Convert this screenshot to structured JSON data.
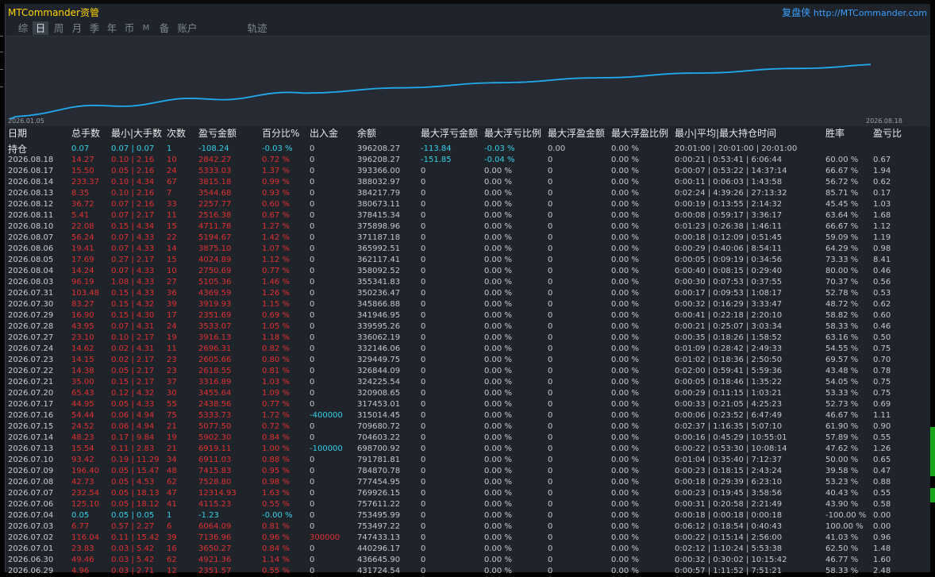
{
  "app": {
    "title": "MTCommander资管",
    "brand_cn": "复盘侠",
    "brand_url": "http://MTCommander.com"
  },
  "tabs": [
    "综",
    "日",
    "周",
    "月",
    "季",
    "年",
    "币",
    "M",
    "备",
    "账户",
    "轨迹"
  ],
  "active_tab": 1,
  "chart_data": {
    "type": "line",
    "x_start_label": "2026.01.05",
    "x_end_label": "2026.08.18",
    "line_color": "#22aaee"
  },
  "columns": [
    "日期",
    "总手数",
    "最小|大手数",
    "次数",
    "盈亏金额",
    "百分比%",
    "出入金",
    "余额",
    "最大浮亏金额",
    "最大浮亏比例",
    "最大浮盈金额",
    "最大浮盈比例",
    "最小|平均|最大持仓时间",
    "胜率",
    "盈亏比"
  ],
  "position_row": {
    "label": "持仓",
    "lots": "0.07",
    "minmax": "0.07 | 0.07",
    "count": "1",
    "pnl": "-108.24",
    "pct": "-0.03 %",
    "flow": "0",
    "balance": "396208.27",
    "float_loss": "-113.84",
    "float_loss_pct": "-0.03 %",
    "float_profit": "0.00",
    "float_profit_pct": "0.00 %",
    "hold_time": "20:01:00 | 20:01:00 | 20:01:00",
    "winrate": "",
    "pf": ""
  },
  "rows": [
    {
      "date": "2026.08.18",
      "lots": "14.27",
      "minmax": "0.10 | 2.16",
      "count": "10",
      "pnl": "2842.27",
      "pct": "0.72 %",
      "flow": "0",
      "balance": "396208.27",
      "float_loss": "-151.85",
      "float_loss_pct": "-0.04 %",
      "float_profit": "0",
      "float_profit_pct": "0.00 %",
      "hold_time": "0:00:21 | 0:53:41 | 6:06:44",
      "winrate": "60.00 %",
      "pf": "0.67"
    },
    {
      "date": "2026.08.17",
      "lots": "15.50",
      "minmax": "0.05 | 2.16",
      "count": "24",
      "pnl": "5333.03",
      "pct": "1.37 %",
      "flow": "0",
      "balance": "393366.00",
      "float_loss": "0",
      "float_loss_pct": "0.00 %",
      "float_profit": "0",
      "float_profit_pct": "0.00 %",
      "hold_time": "0:00:07 | 0:53:22 | 14:37:14",
      "winrate": "66.67 %",
      "pf": "1.94"
    },
    {
      "date": "2026.08.14",
      "lots": "233.37",
      "minmax": "0.10 | 4.34",
      "count": "67",
      "pnl": "3815.18",
      "pct": "0.99 %",
      "flow": "0",
      "balance": "388032.97",
      "float_loss": "0",
      "float_loss_pct": "0.00 %",
      "float_profit": "0",
      "float_profit_pct": "0.00 %",
      "hold_time": "0:00:11 | 0:06:03 | 1:43:58",
      "winrate": "56.72 %",
      "pf": "0.62"
    },
    {
      "date": "2026.08.13",
      "lots": "8.35",
      "minmax": "0.10 | 2.16",
      "count": "7",
      "pnl": "3544.68",
      "pct": "0.93 %",
      "flow": "0",
      "balance": "384217.79",
      "float_loss": "0",
      "float_loss_pct": "0.00 %",
      "float_profit": "0",
      "float_profit_pct": "0.00 %",
      "hold_time": "0:02:24 | 4:39:26 | 27:13:32",
      "winrate": "85.71 %",
      "pf": "0.17"
    },
    {
      "date": "2026.08.12",
      "lots": "36.72",
      "minmax": "0.07 | 2.16",
      "count": "33",
      "pnl": "2257.77",
      "pct": "0.60 %",
      "flow": "0",
      "balance": "380673.11",
      "float_loss": "0",
      "float_loss_pct": "0.00 %",
      "float_profit": "0",
      "float_profit_pct": "0.00 %",
      "hold_time": "0:00:19 | 0:13:55 | 2:14:32",
      "winrate": "45.45 %",
      "pf": "1.03"
    },
    {
      "date": "2026.08.11",
      "lots": "5.41",
      "minmax": "0.07 | 2.17",
      "count": "11",
      "pnl": "2516.38",
      "pct": "0.67 %",
      "flow": "0",
      "balance": "378415.34",
      "float_loss": "0",
      "float_loss_pct": "0.00 %",
      "float_profit": "0",
      "float_profit_pct": "0.00 %",
      "hold_time": "0:00:08 | 0:59:17 | 3:36:17",
      "winrate": "63.64 %",
      "pf": "1.68"
    },
    {
      "date": "2026.08.10",
      "lots": "22.08",
      "minmax": "0.15 | 4.34",
      "count": "15",
      "pnl": "4711.78",
      "pct": "1.27 %",
      "flow": "0",
      "balance": "375898.96",
      "float_loss": "0",
      "float_loss_pct": "0.00 %",
      "float_profit": "0",
      "float_profit_pct": "0.00 %",
      "hold_time": "0:01:23 | 0:26:38 | 1:46:11",
      "winrate": "66.67 %",
      "pf": "1.12"
    },
    {
      "date": "2026.08.07",
      "lots": "56.24",
      "minmax": "0.07 | 4.33",
      "count": "22",
      "pnl": "5194.67",
      "pct": "1.42 %",
      "flow": "0",
      "balance": "371187.18",
      "float_loss": "0",
      "float_loss_pct": "0.00 %",
      "float_profit": "0",
      "float_profit_pct": "0.00 %",
      "hold_time": "0:00:18 | 0:12:09 | 0:51:45",
      "winrate": "59.09 %",
      "pf": "1.19"
    },
    {
      "date": "2026.08.06",
      "lots": "19.41",
      "minmax": "0.07 | 4.33",
      "count": "14",
      "pnl": "3875.10",
      "pct": "1.07 %",
      "flow": "0",
      "balance": "365992.51",
      "float_loss": "0",
      "float_loss_pct": "0.00 %",
      "float_profit": "0",
      "float_profit_pct": "0.00 %",
      "hold_time": "0:00:29 | 0:40:06 | 8:54:11",
      "winrate": "64.29 %",
      "pf": "0.98"
    },
    {
      "date": "2026.08.05",
      "lots": "17.69",
      "minmax": "0.27 | 2.17",
      "count": "15",
      "pnl": "4024.89",
      "pct": "1.12 %",
      "flow": "0",
      "balance": "362117.41",
      "float_loss": "0",
      "float_loss_pct": "0.00 %",
      "float_profit": "0",
      "float_profit_pct": "0.00 %",
      "hold_time": "0:00:05 | 0:09:19 | 0:34:56",
      "winrate": "73.33 %",
      "pf": "8.41"
    },
    {
      "date": "2026.08.04",
      "lots": "14.24",
      "minmax": "0.07 | 4.33",
      "count": "10",
      "pnl": "2750.69",
      "pct": "0.77 %",
      "flow": "0",
      "balance": "358092.52",
      "float_loss": "0",
      "float_loss_pct": "0.00 %",
      "float_profit": "0",
      "float_profit_pct": "0.00 %",
      "hold_time": "0:00:40 | 0:08:15 | 0:29:40",
      "winrate": "80.00 %",
      "pf": "0.46"
    },
    {
      "date": "2026.08.03",
      "lots": "96.19",
      "minmax": "1.08 | 4.33",
      "count": "27",
      "pnl": "5105.36",
      "pct": "1.46 %",
      "flow": "0",
      "balance": "355341.83",
      "float_loss": "0",
      "float_loss_pct": "0.00 %",
      "float_profit": "0",
      "float_profit_pct": "0.00 %",
      "hold_time": "0:00:30 | 0:07:53 | 0:37:55",
      "winrate": "70.37 %",
      "pf": "0.56"
    },
    {
      "date": "2026.07.31",
      "lots": "103.48",
      "minmax": "0.15 | 4.33",
      "count": "36",
      "pnl": "4369.59",
      "pct": "1.26 %",
      "flow": "0",
      "balance": "350236.47",
      "float_loss": "0",
      "float_loss_pct": "0.00 %",
      "float_profit": "0",
      "float_profit_pct": "0.00 %",
      "hold_time": "0:00:17 | 0:09:53 | 1:08:17",
      "winrate": "52.78 %",
      "pf": "0.53"
    },
    {
      "date": "2026.07.30",
      "lots": "83.27",
      "minmax": "0.15 | 4.32",
      "count": "39",
      "pnl": "3919.93",
      "pct": "1.15 %",
      "flow": "0",
      "balance": "345866.88",
      "float_loss": "0",
      "float_loss_pct": "0.00 %",
      "float_profit": "0",
      "float_profit_pct": "0.00 %",
      "hold_time": "0:00:32 | 0:16:29 | 3:33:47",
      "winrate": "48.72 %",
      "pf": "0.62"
    },
    {
      "date": "2026.07.29",
      "lots": "16.90",
      "minmax": "0.15 | 4.30",
      "count": "17",
      "pnl": "2351.69",
      "pct": "0.69 %",
      "flow": "0",
      "balance": "341946.95",
      "float_loss": "0",
      "float_loss_pct": "0.00 %",
      "float_profit": "0",
      "float_profit_pct": "0.00 %",
      "hold_time": "0:00:41 | 0:22:18 | 2:20:10",
      "winrate": "58.82 %",
      "pf": "0.60"
    },
    {
      "date": "2026.07.28",
      "lots": "43.95",
      "minmax": "0.07 | 4.31",
      "count": "24",
      "pnl": "3533.07",
      "pct": "1.05 %",
      "flow": "0",
      "balance": "339595.26",
      "float_loss": "0",
      "float_loss_pct": "0.00 %",
      "float_profit": "0",
      "float_profit_pct": "0.00 %",
      "hold_time": "0:00:21 | 0:25:07 | 3:03:34",
      "winrate": "58.33 %",
      "pf": "0.46"
    },
    {
      "date": "2026.07.27",
      "lots": "23.10",
      "minmax": "0.10 | 2.17",
      "count": "19",
      "pnl": "3916.13",
      "pct": "1.18 %",
      "flow": "0",
      "balance": "336062.19",
      "float_loss": "0",
      "float_loss_pct": "0.00 %",
      "float_profit": "0",
      "float_profit_pct": "0.00 %",
      "hold_time": "0:00:35 | 0:18:26 | 1:58:52",
      "winrate": "63.16 %",
      "pf": "0.50"
    },
    {
      "date": "2026.07.24",
      "lots": "14.62",
      "minmax": "0.02 | 4.31",
      "count": "11",
      "pnl": "2696.31",
      "pct": "0.82 %",
      "flow": "0",
      "balance": "332146.06",
      "float_loss": "0",
      "float_loss_pct": "0.00 %",
      "float_profit": "0",
      "float_profit_pct": "0.00 %",
      "hold_time": "0:01:09 | 0:28:42 | 2:49:33",
      "winrate": "54.55 %",
      "pf": "0.75"
    },
    {
      "date": "2026.07.23",
      "lots": "14.15",
      "minmax": "0.02 | 2.17",
      "count": "23",
      "pnl": "2605.66",
      "pct": "0.80 %",
      "flow": "0",
      "balance": "329449.75",
      "float_loss": "0",
      "float_loss_pct": "0.00 %",
      "float_profit": "0",
      "float_profit_pct": "0.00 %",
      "hold_time": "0:01:02 | 0:18:36 | 2:50:50",
      "winrate": "69.57 %",
      "pf": "0.70"
    },
    {
      "date": "2026.07.22",
      "lots": "14.38",
      "minmax": "0.05 | 2.17",
      "count": "23",
      "pnl": "2618.55",
      "pct": "0.81 %",
      "flow": "0",
      "balance": "326844.09",
      "float_loss": "0",
      "float_loss_pct": "0.00 %",
      "float_profit": "0",
      "float_profit_pct": "0.00 %",
      "hold_time": "0:02:00 | 0:59:41 | 5:59:36",
      "winrate": "43.48 %",
      "pf": "0.78"
    },
    {
      "date": "2026.07.21",
      "lots": "35.00",
      "minmax": "0.15 | 2.17",
      "count": "37",
      "pnl": "3316.89",
      "pct": "1.03 %",
      "flow": "0",
      "balance": "324225.54",
      "float_loss": "0",
      "float_loss_pct": "0.00 %",
      "float_profit": "0",
      "float_profit_pct": "0.00 %",
      "hold_time": "0:00:05 | 0:18:46 | 1:35:22",
      "winrate": "54.05 %",
      "pf": "0.75"
    },
    {
      "date": "2026.07.20",
      "lots": "65.43",
      "minmax": "0.12 | 4.32",
      "count": "30",
      "pnl": "3455.64",
      "pct": "1.09 %",
      "flow": "0",
      "balance": "320908.65",
      "float_loss": "0",
      "float_loss_pct": "0.00 %",
      "float_profit": "0",
      "float_profit_pct": "0.00 %",
      "hold_time": "0:00:29 | 0:11:15 | 1:03:21",
      "winrate": "53.33 %",
      "pf": "0.75"
    },
    {
      "date": "2026.07.17",
      "lots": "44.95",
      "minmax": "0.05 | 4.33",
      "count": "55",
      "pnl": "2438.56",
      "pct": "0.77 %",
      "flow": "0",
      "balance": "317453.01",
      "float_loss": "0",
      "float_loss_pct": "0.00 %",
      "float_profit": "0",
      "float_profit_pct": "0.00 %",
      "hold_time": "0:00:33 | 0:21:05 | 4:25:23",
      "winrate": "52.73 %",
      "pf": "0.69"
    },
    {
      "date": "2026.07.16",
      "lots": "54.44",
      "minmax": "0.06 | 4.94",
      "count": "75",
      "pnl": "5333.73",
      "pct": "1.72 %",
      "flow": "-400000",
      "balance": "315014.45",
      "float_loss": "0",
      "float_loss_pct": "0.00 %",
      "float_profit": "0",
      "float_profit_pct": "0.00 %",
      "hold_time": "0:00:06 | 0:23:52 | 6:47:49",
      "winrate": "46.67 %",
      "pf": "1.11"
    },
    {
      "date": "2026.07.15",
      "lots": "24.52",
      "minmax": "0.06 | 4.94",
      "count": "21",
      "pnl": "5077.50",
      "pct": "0.72 %",
      "flow": "0",
      "balance": "709680.72",
      "float_loss": "0",
      "float_loss_pct": "0.00 %",
      "float_profit": "0",
      "float_profit_pct": "0.00 %",
      "hold_time": "0:02:37 | 1:16:35 | 5:07:10",
      "winrate": "61.90 %",
      "pf": "0.90"
    },
    {
      "date": "2026.07.14",
      "lots": "48.23",
      "minmax": "0.17 | 9.84",
      "count": "19",
      "pnl": "5902.30",
      "pct": "0.84 %",
      "flow": "0",
      "balance": "704603.22",
      "float_loss": "0",
      "float_loss_pct": "0.00 %",
      "float_profit": "0",
      "float_profit_pct": "0.00 %",
      "hold_time": "0:00:16 | 0:45:29 | 10:55:01",
      "winrate": "57.89 %",
      "pf": "0.55"
    },
    {
      "date": "2026.07.13",
      "lots": "15.54",
      "minmax": "0.11 | 2.83",
      "count": "21",
      "pnl": "6919.11",
      "pct": "1.00 %",
      "flow": "-100000",
      "balance": "698700.92",
      "float_loss": "0",
      "float_loss_pct": "0.00 %",
      "float_profit": "0",
      "float_profit_pct": "0.00 %",
      "hold_time": "0:00:22 | 0:53:30 | 10:08:14",
      "winrate": "47.62 %",
      "pf": "1.26"
    },
    {
      "date": "2026.07.10",
      "lots": "93.42",
      "minmax": "0.19 | 11.29",
      "count": "34",
      "pnl": "6911.03",
      "pct": "0.88 %",
      "flow": "0",
      "balance": "791781.81",
      "float_loss": "0",
      "float_loss_pct": "0.00 %",
      "float_profit": "0",
      "float_profit_pct": "0.00 %",
      "hold_time": "0:01:04 | 0:35:40 | 7:12:37",
      "winrate": "50.00 %",
      "pf": "0.65"
    },
    {
      "date": "2026.07.09",
      "lots": "196.40",
      "minmax": "0.05 | 15.47",
      "count": "48",
      "pnl": "7415.83",
      "pct": "0.95 %",
      "flow": "0",
      "balance": "784870.78",
      "float_loss": "0",
      "float_loss_pct": "0.00 %",
      "float_profit": "0",
      "float_profit_pct": "0.00 %",
      "hold_time": "0:00:23 | 0:18:15 | 2:43:24",
      "winrate": "39.58 %",
      "pf": "0.47"
    },
    {
      "date": "2026.07.08",
      "lots": "42.73",
      "minmax": "0.05 | 4.53",
      "count": "62",
      "pnl": "7528.80",
      "pct": "0.98 %",
      "flow": "0",
      "balance": "777454.95",
      "float_loss": "0",
      "float_loss_pct": "0.00 %",
      "float_profit": "0",
      "float_profit_pct": "0.00 %",
      "hold_time": "0:00:18 | 0:29:39 | 6:23:10",
      "winrate": "53.23 %",
      "pf": "0.88"
    },
    {
      "date": "2026.07.07",
      "lots": "232.54",
      "minmax": "0.05 | 18.13",
      "count": "47",
      "pnl": "12314.93",
      "pct": "1.63 %",
      "flow": "0",
      "balance": "769926.15",
      "float_loss": "0",
      "float_loss_pct": "0.00 %",
      "float_profit": "0",
      "float_profit_pct": "0.00 %",
      "hold_time": "0:00:23 | 0:19:45 | 3:58:56",
      "winrate": "40.43 %",
      "pf": "0.55"
    },
    {
      "date": "2026.07.06",
      "lots": "125.10",
      "minmax": "0.05 | 18.12",
      "count": "41",
      "pnl": "4115.23",
      "pct": "0.55 %",
      "flow": "0",
      "balance": "757611.22",
      "float_loss": "0",
      "float_loss_pct": "0.00 %",
      "float_profit": "0",
      "float_profit_pct": "0.00 %",
      "hold_time": "0:00:31 | 0:20:58 | 2:21:49",
      "winrate": "43.90 %",
      "pf": "0.58"
    },
    {
      "date": "2026.07.04",
      "lots": "0.05",
      "minmax": "0.05 | 0.05",
      "count": "1",
      "pnl": "-1.23",
      "pct": "-0.00 %",
      "flow": "0",
      "balance": "753495.99",
      "float_loss": "0",
      "float_loss_pct": "0.00 %",
      "float_profit": "0",
      "float_profit_pct": "0.00 %",
      "hold_time": "0:00:18 | 0:00:18 | 0:00:18",
      "winrate": "-100.00 %",
      "pf": "0.00"
    },
    {
      "date": "2026.07.03",
      "lots": "6.77",
      "minmax": "0.57 | 2.27",
      "count": "6",
      "pnl": "6064.09",
      "pct": "0.81 %",
      "flow": "0",
      "balance": "753497.22",
      "float_loss": "0",
      "float_loss_pct": "0.00 %",
      "float_profit": "0",
      "float_profit_pct": "0.00 %",
      "hold_time": "0:06:12 | 0:18:54 | 0:40:43",
      "winrate": "100.00 %",
      "pf": "0.00"
    },
    {
      "date": "2026.07.02",
      "lots": "116.04",
      "minmax": "0.11 | 15.42",
      "count": "39",
      "pnl": "7136.96",
      "pct": "0.96 %",
      "flow": "300000",
      "balance": "747433.13",
      "float_loss": "0",
      "float_loss_pct": "0.00 %",
      "float_profit": "0",
      "float_profit_pct": "0.00 %",
      "hold_time": "0:00:22 | 0:15:14 | 2:56:00",
      "winrate": "41.03 %",
      "pf": "0.96"
    },
    {
      "date": "2026.07.01",
      "lots": "23.83",
      "minmax": "0.03 | 5.42",
      "count": "16",
      "pnl": "3650.27",
      "pct": "0.84 %",
      "flow": "0",
      "balance": "440296.17",
      "float_loss": "0",
      "float_loss_pct": "0.00 %",
      "float_profit": "0",
      "float_profit_pct": "0.00 %",
      "hold_time": "0:02:12 | 1:10:24 | 5:53:38",
      "winrate": "62.50 %",
      "pf": "1.48"
    },
    {
      "date": "2026.06.30",
      "lots": "49.46",
      "minmax": "0.03 | 5.42",
      "count": "62",
      "pnl": "4921.36",
      "pct": "1.14 %",
      "flow": "0",
      "balance": "436645.90",
      "float_loss": "0",
      "float_loss_pct": "0.00 %",
      "float_profit": "0",
      "float_profit_pct": "0.00 %",
      "hold_time": "0:00:32 | 0:30:02 | 10:15:42",
      "winrate": "46.77 %",
      "pf": "1.60"
    },
    {
      "date": "2026.06.29",
      "lots": "4.96",
      "minmax": "0.03 | 2.71",
      "count": "12",
      "pnl": "2351.57",
      "pct": "0.55 %",
      "flow": "0",
      "balance": "431724.54",
      "float_loss": "0",
      "float_loss_pct": "0.00 %",
      "float_profit": "0",
      "float_profit_pct": "0.00 %",
      "hold_time": "0:00:57 | 1:11:52 | 7:51:21",
      "winrate": "58.33 %",
      "pf": "2.48"
    }
  ]
}
